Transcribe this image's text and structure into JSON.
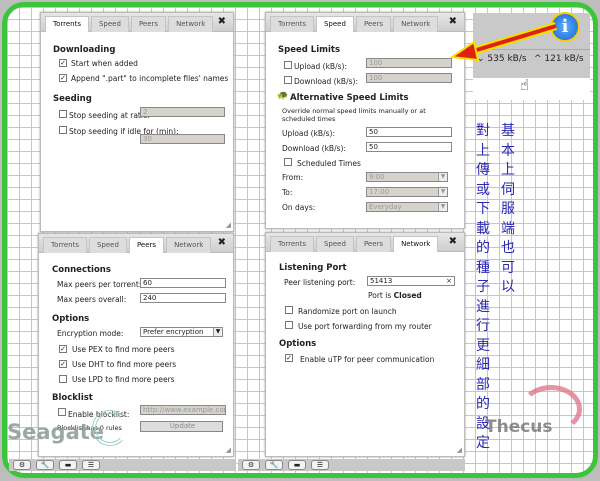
{
  "tabs": [
    "Torrents",
    "Speed",
    "Peers",
    "Network"
  ],
  "torrents": {
    "downloading": "Downloading",
    "start_when_added": "Start when added",
    "append_part": "Append \".part\" to incomplete files' names",
    "seeding": "Seeding",
    "stop_ratio": "Stop seeding at ratio:",
    "ratio_value": "2",
    "stop_idle": "Stop seeding if idle for (min):",
    "idle_value": "30"
  },
  "speed": {
    "title": "Speed Limits",
    "upload": "Upload (kB/s):",
    "upload_value": "100",
    "download": "Download (kB/s):",
    "download_value": "100",
    "alt_title": "Alternative Speed Limits",
    "alt_desc": "Override normal speed limits manually or at scheduled times",
    "alt_upload": "Upload (kB/s):",
    "alt_upload_value": "50",
    "alt_download": "Download (kB/s):",
    "alt_download_value": "50",
    "scheduled": "Scheduled Times",
    "from": "From:",
    "from_value": "9:00",
    "to": "To:",
    "to_value": "17:00",
    "on_days": "On days:",
    "on_days_value": "Everyday"
  },
  "peers": {
    "connections": "Connections",
    "max_per_torrent": "Max peers per torrent:",
    "max_per_torrent_value": "60",
    "max_overall": "Max peers overall:",
    "max_overall_value": "240",
    "options": "Options",
    "encryption": "Encryption mode:",
    "encryption_value": "Prefer encryption",
    "pex": "Use PEX to find more peers",
    "dht": "Use DHT to find more peers",
    "lpd": "Use LPD to find more peers",
    "blocklist": "Blocklist",
    "enable_blocklist": "Enable blocklist:",
    "blocklist_url": "http://www.example.com/b",
    "blocklist_rules": "Blocklist has 0 rules",
    "update": "Update"
  },
  "network": {
    "listening": "Listening Port",
    "peer_port": "Peer listening port:",
    "peer_port_value": "51413",
    "port_status_prefix": "Port is",
    "port_status": "Closed",
    "randomize": "Randomize port on launch",
    "port_forwarding": "Use port forwarding from my router",
    "options": "Options",
    "utp": "Enable uTP for peer communication"
  },
  "status": {
    "down_speed": "535 kB/s",
    "up_speed": "121 kB/s"
  },
  "annotation": {
    "col_right": "基本上伺服端也可以",
    "col_left": "對上傳或下載的種子進行更細部的設定"
  },
  "logos": {
    "seagate": "Seagate",
    "thecus": "Thecus"
  },
  "colors": {
    "border": "#3cc43a",
    "annotation_text": "#2c2ab0",
    "arrow": "#e02010"
  }
}
